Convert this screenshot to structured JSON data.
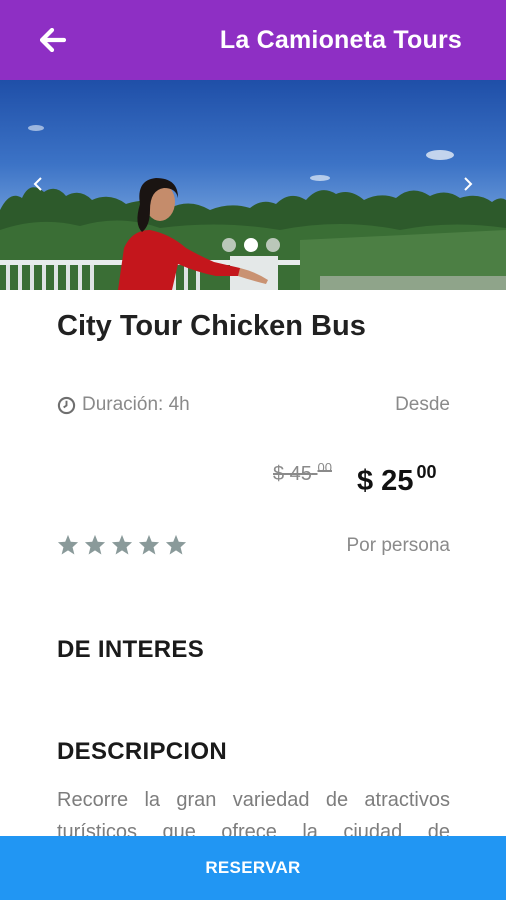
{
  "app_bar": {
    "title": "La Camioneta Tours",
    "background_color": "#8e2fc4",
    "back_icon": "arrow-left-icon"
  },
  "carousel": {
    "slide_count": 3,
    "active_index": 1,
    "prev_icon": "chevron-left-icon",
    "next_icon": "chevron-right-icon"
  },
  "tour": {
    "title": "City Tour Chicken Bus",
    "duration_icon": "clock-icon",
    "duration_label": "Duración: 4h",
    "from_label": "Desde",
    "old_price_main": "$ 45",
    "old_price_cents": "00",
    "new_price_main": "$ 25",
    "new_price_cents": "00",
    "rating_stars": 5,
    "star_color": "#8a9a9a",
    "per_person_label": "Por persona"
  },
  "sections": {
    "interest_heading": "DE INTERES",
    "description_heading": "DESCRIPCION",
    "description_text": "Recorre la gran variedad de atractivos turísticos que ofrece la ciudad de"
  },
  "footer": {
    "reserve_label": "RESERVAR",
    "button_color": "#2196f3"
  }
}
